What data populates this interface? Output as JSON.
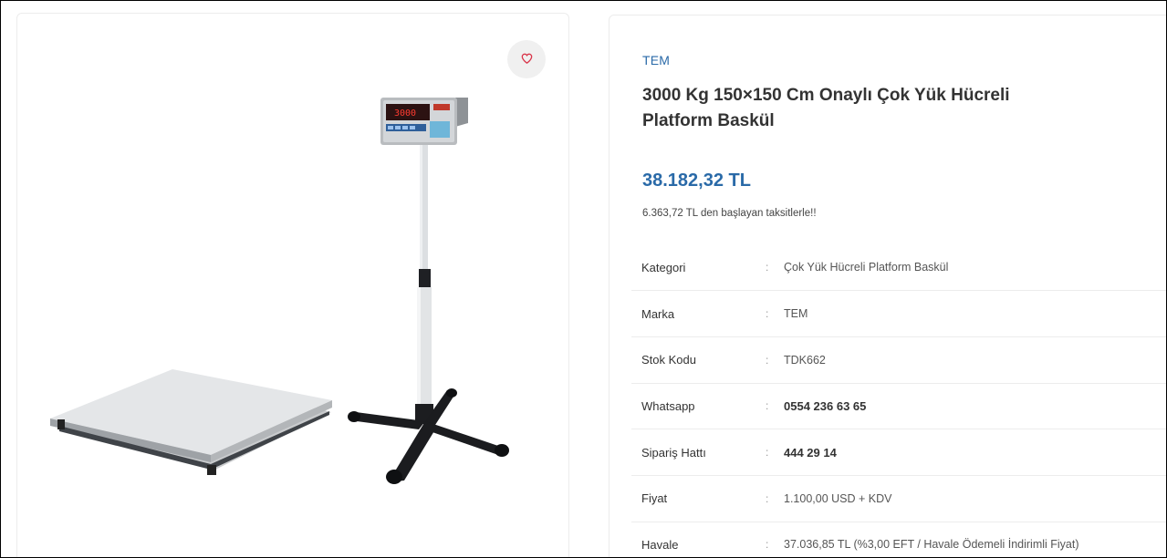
{
  "product": {
    "brand": "TEM",
    "title": "3000 Kg 150×150 Cm Onaylı Çok Yük Hücreli Platform Baskül",
    "price": "38.182,32 TL",
    "installment_note": "6.363,72 TL den başlayan taksitlerle!!"
  },
  "gallery": {
    "image_alt": "3000 Kg 150×150 Cm Onaylı Çok Yük Hücreli Platform Baskül",
    "indicator_display": "3000"
  },
  "specs": [
    {
      "label": "Kategori",
      "sep": ":",
      "value": "Çok Yük Hücreli Platform Baskül"
    },
    {
      "label": "Marka",
      "sep": ":",
      "value": "TEM"
    },
    {
      "label": "Stok Kodu",
      "sep": ":",
      "value": "TDK662"
    },
    {
      "label": "Whatsapp",
      "sep": ":",
      "value": "0554 236 63 65"
    },
    {
      "label": "Sipariş Hattı",
      "sep": ":",
      "value": "444 29 14"
    },
    {
      "label": "Fiyat",
      "sep": ":",
      "value": "1.100,00 USD + KDV"
    },
    {
      "label": "Havale",
      "sep": ":",
      "value": "37.036,85 TL (%3,00 EFT / Havale Ödemeli İndirimli Fiyat)"
    }
  ],
  "colors": {
    "accent": "#2a6aa8",
    "heart": "#d9354a",
    "border": "#ececec"
  },
  "icons": {
    "favorite": "heart-outline-icon"
  }
}
